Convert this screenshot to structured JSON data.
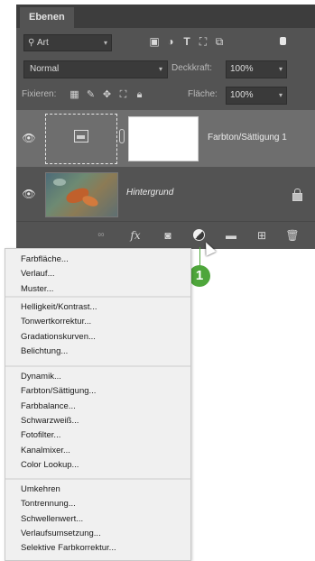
{
  "panel": {
    "tab_label": "Ebenen",
    "search": {
      "value": "Art"
    },
    "blend_mode": "Normal",
    "opacity_label": "Deckkraft:",
    "opacity_value": "100%",
    "lock_label": "Fixieren:",
    "fill_label": "Fläche:",
    "fill_value": "100%"
  },
  "layers": [
    {
      "name": "Farbton/Sättigung 1",
      "visible": true,
      "type": "adjustment"
    },
    {
      "name": "Hintergrund",
      "visible": true,
      "type": "image",
      "locked": true
    }
  ],
  "bottombar": {
    "fx_label": "fx"
  },
  "callout": {
    "number": "1",
    "color": "#4ea63b"
  },
  "menu": {
    "groups": [
      [
        "Farbfläche...",
        "Verlauf...",
        "Muster..."
      ],
      [
        "Helligkeit/Kontrast...",
        "Tonwertkorrektur...",
        "Gradationskurven...",
        "Belichtung..."
      ],
      [
        "Dynamik...",
        "Farbton/Sättigung...",
        "Farbbalance...",
        "Schwarzweiß...",
        "Fotofilter...",
        "Kanalmixer...",
        "Color Lookup..."
      ],
      [
        "Umkehren",
        "Tontrennung...",
        "Schwellenwert...",
        "Verlaufsumsetzung...",
        "Selektive Farbkorrektur..."
      ]
    ]
  }
}
